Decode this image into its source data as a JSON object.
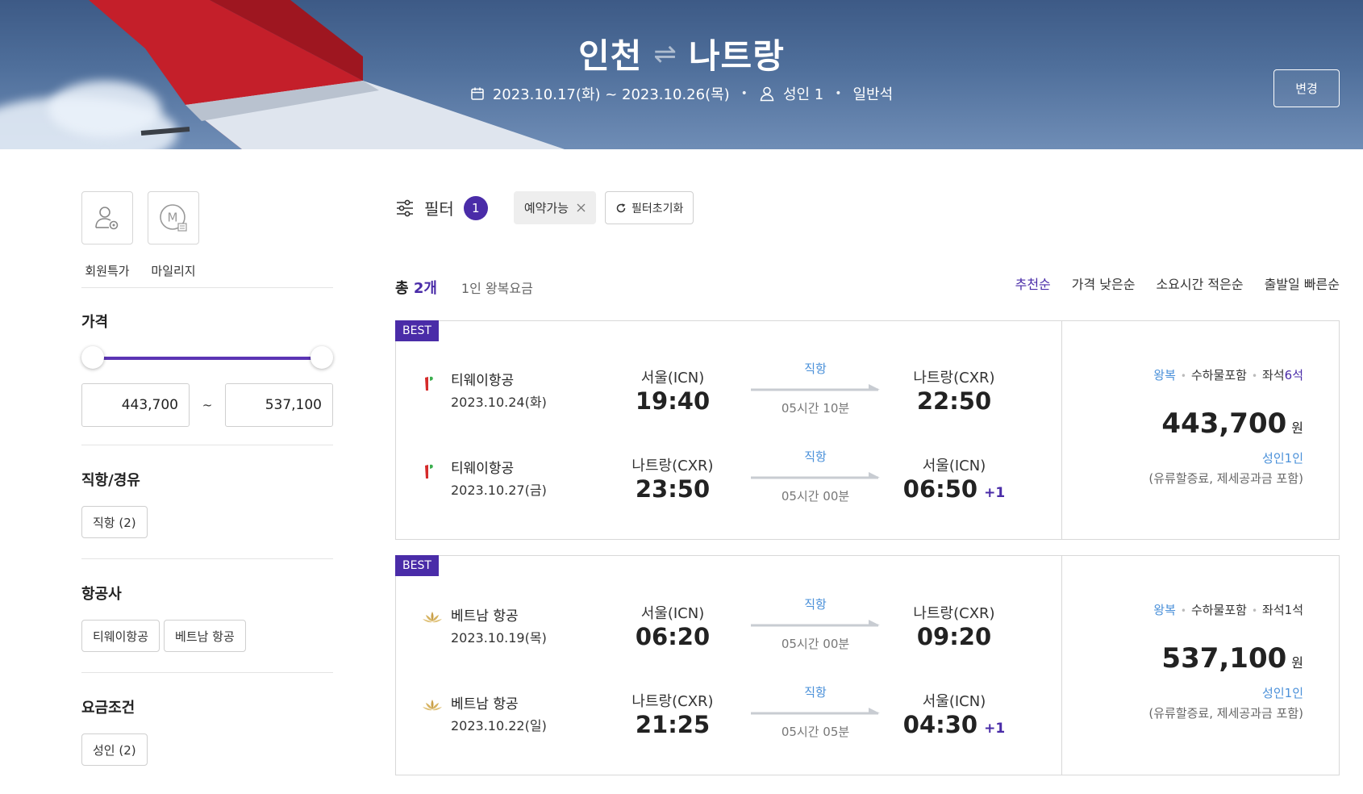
{
  "header": {
    "origin": "인천",
    "destination": "나트랑",
    "swap_symbol": "⇌",
    "dates": "2023.10.17(화) ~ 2023.10.26(목)",
    "passengers": "성인 1",
    "cabin": "일반석",
    "change_label": "변경"
  },
  "sidebar": {
    "quick": [
      {
        "label": "회원특가",
        "icon": "member-gift-icon"
      },
      {
        "label": "마일리지",
        "icon": "mileage-icon"
      }
    ],
    "price": {
      "title": "가격",
      "min": "443,700",
      "max": "537,100",
      "tilde": "~"
    },
    "stops": {
      "title": "직항/경유",
      "options": [
        "직항 (2)"
      ]
    },
    "airlines": {
      "title": "항공사",
      "options": [
        "티웨이항공",
        "베트남 항공"
      ]
    },
    "fare": {
      "title": "요금조건",
      "options": [
        "성인 (2)"
      ]
    }
  },
  "filterbar": {
    "label": "필터",
    "count": "1",
    "active_tag": "예약가능",
    "reset_label": "필터초기화"
  },
  "summary": {
    "total_prefix": "총 ",
    "total_count": "2개",
    "per_person": "1인 왕복요금"
  },
  "sorts": [
    "추천순",
    "가격 낮은순",
    "소요시간 적은순",
    "출발일 빠른순"
  ],
  "results": [
    {
      "badge": "BEST",
      "legs": [
        {
          "airline": "티웨이항공",
          "date": "2023.10.24(화)",
          "dep_city": "서울(ICN)",
          "dep_time": "19:40",
          "type": "직항",
          "duration": "05시간 10분",
          "arr_city": "나트랑(CXR)",
          "arr_time": "22:50",
          "plus": ""
        },
        {
          "airline": "티웨이항공",
          "date": "2023.10.27(금)",
          "dep_city": "나트랑(CXR)",
          "dep_time": "23:50",
          "type": "직항",
          "duration": "05시간 00분",
          "arr_city": "서울(ICN)",
          "arr_time": "06:50",
          "plus": "+1"
        }
      ],
      "price": {
        "round_trip": "왕복",
        "baggage": "수하물포함",
        "seats_prefix": "좌석",
        "seats_num": "6석",
        "amount": "443,700",
        "won": "원",
        "adult": "성인1인",
        "note": "(유류할증료, 제세공과금 포함)"
      }
    },
    {
      "badge": "BEST",
      "legs": [
        {
          "airline": "베트남 항공",
          "date": "2023.10.19(목)",
          "dep_city": "서울(ICN)",
          "dep_time": "06:20",
          "type": "직항",
          "duration": "05시간 00분",
          "arr_city": "나트랑(CXR)",
          "arr_time": "09:20",
          "plus": ""
        },
        {
          "airline": "베트남 항공",
          "date": "2023.10.22(일)",
          "dep_city": "나트랑(CXR)",
          "dep_time": "21:25",
          "type": "직항",
          "duration": "05시간 05분",
          "arr_city": "서울(ICN)",
          "arr_time": "04:30",
          "plus": "+1"
        }
      ],
      "price": {
        "round_trip": "왕복",
        "baggage": "수하물포함",
        "seats_prefix": "좌석",
        "seats_num": "1석",
        "amount": "537,100",
        "won": "원",
        "adult": "성인1인",
        "note": "(유류할증료, 제세공과금 포함)"
      }
    }
  ],
  "colors": {
    "accent": "#4a2ca8",
    "link_blue": "#4a90d9",
    "tway_red": "#d52b2b",
    "vn_gold": "#c9a04a"
  }
}
